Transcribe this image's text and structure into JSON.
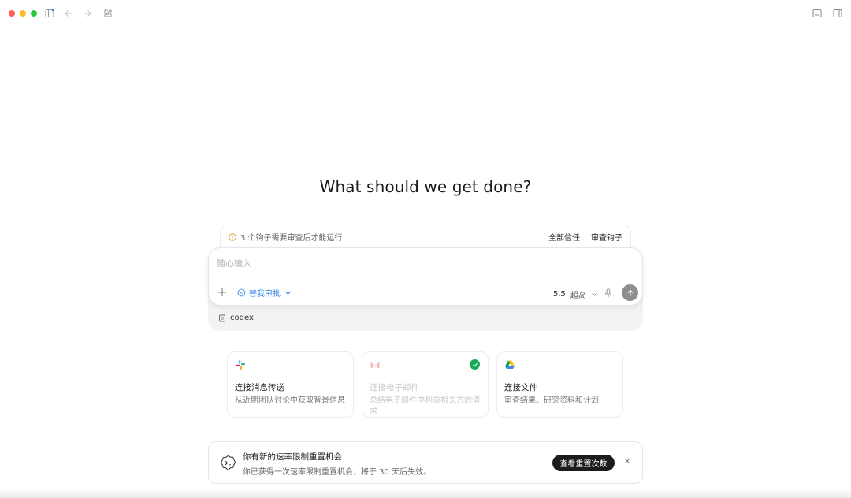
{
  "colors": {
    "accent": "#2f86e8",
    "success": "#18a957",
    "dark_button": "#1c1c1c",
    "warning": "#e5a03a"
  },
  "titlebar": {
    "icons": [
      "sidebar-toggle-icon",
      "back-arrow-icon",
      "forward-arrow-icon",
      "new-chat-icon",
      "terminal-panel-icon",
      "right-panel-icon"
    ]
  },
  "headline": "What should we get done?",
  "hooks_banner": {
    "message": "3 个钩子需要审查后才能运行",
    "trust_all": "全部信任",
    "review": "审查钩子"
  },
  "composer": {
    "placeholder": "随心输入",
    "approval_mode": "替我审批",
    "model": "5.5",
    "effort": "超高",
    "project": "codex"
  },
  "cards": [
    {
      "title": "连接消息传送",
      "desc": "从近期团队讨论中获取背景信息",
      "icon": "slack-icon",
      "connected": false
    },
    {
      "title": "连接电子邮件",
      "desc": "总结电子邮件中利益相关方的请求",
      "icon": "gmail-icon",
      "connected": true
    },
    {
      "title": "连接文件",
      "desc": "审查结果、研究资料和计划",
      "icon": "drive-icon",
      "connected": false
    }
  ],
  "rate_banner": {
    "title": "你有新的速率限制重置机会",
    "desc": "你已获得一次速率限制重置机会，将于 30 天后失效。",
    "button": "查看重置次数"
  }
}
